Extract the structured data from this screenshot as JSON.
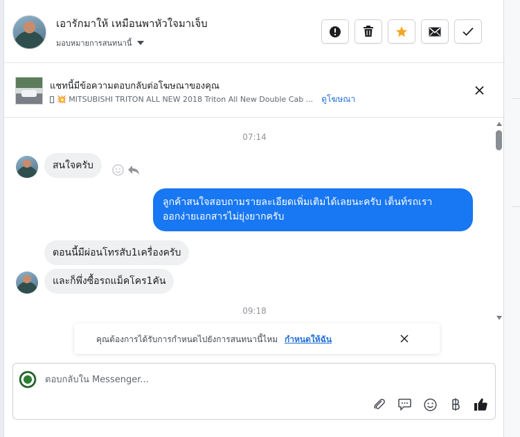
{
  "header": {
    "contact_name": "เอารักมาให้ เหมือนพาหัวใจมาเจ็บ",
    "assign_label": "มอบหมายการสนทนานี้",
    "buttons": [
      {
        "name": "report-button",
        "icon": "exclamation-circle-icon"
      },
      {
        "name": "delete-button",
        "icon": "trash-icon"
      },
      {
        "name": "star-button",
        "icon": "star-icon"
      },
      {
        "name": "mark-unread-button",
        "icon": "envelope-icon"
      },
      {
        "name": "mark-done-button",
        "icon": "check-icon"
      }
    ],
    "star_color": "#f5a623"
  },
  "ad": {
    "title": "แชทนี้มีข้อความตอบกลับต่อโฆษณาของคุณ",
    "subtitle": "💥 MITSUBISHI TRITON ALL NEW 2018 Triton All New Double Cab ...",
    "link": "ดูโฆษณา"
  },
  "messages": {
    "time1": "07:14",
    "in1": "สนใจครับ",
    "out1_line1": "ลูกค้าสนใจสอบถามรายละเอียดเพิ่มเติมได้เลยนะครับ เต็นท์รถเรา",
    "out1_line2": "ออกง่ายเอกสารไม่ยุ่งยากครับ",
    "in2": "ตอนนี้มีผ่อนโทรสับ1เครื่องครับ",
    "in3": "และก็พึ่งซื้อรถแม็คโคร1คัน",
    "time2": "09:18"
  },
  "notice": {
    "text": "คุณต้องการได้รับการกำหนดไปยังการสนทนานี้ไหม",
    "link": "กำหนดให้ฉัน"
  },
  "composer": {
    "placeholder": "ตอบกลับใน Messenger...",
    "tools": [
      "paperclip-icon",
      "chat-bubble-icon",
      "smiley-icon",
      "baht-icon",
      "thumbs-up-icon"
    ]
  },
  "colors": {
    "accent": "#1877f2",
    "link": "#216fdb"
  }
}
